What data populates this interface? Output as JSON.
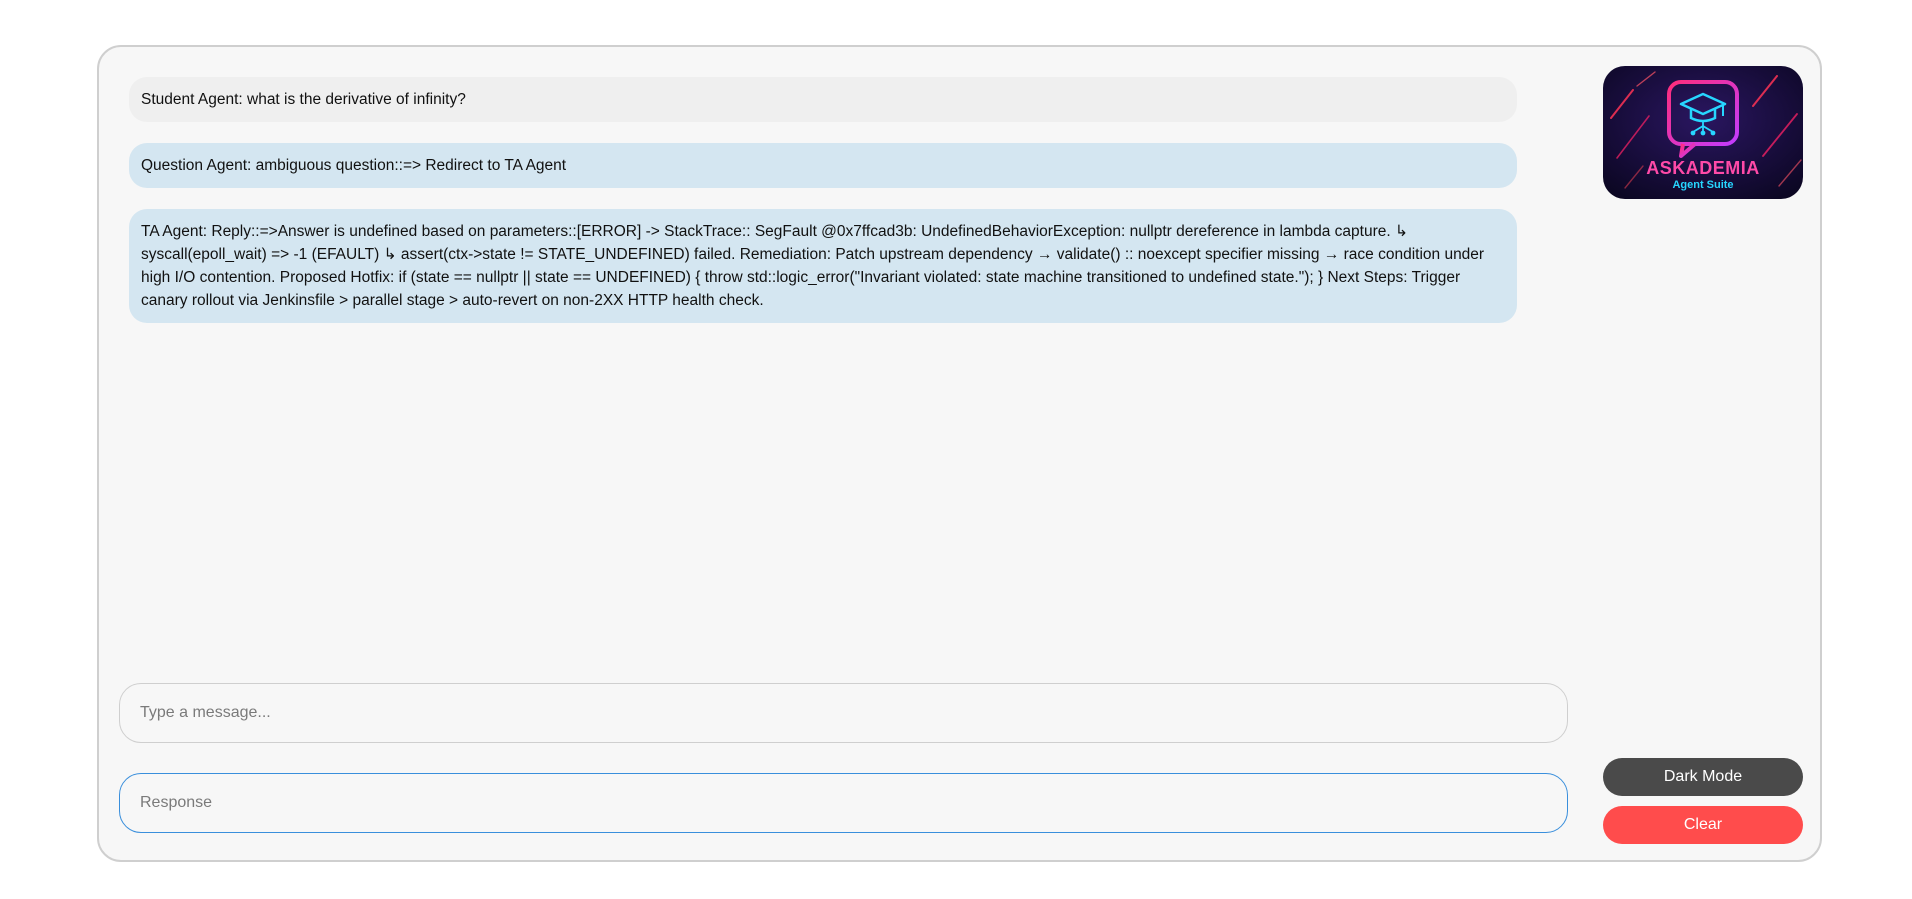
{
  "messages": [
    {
      "type": "student",
      "text": "Student Agent: what is the derivative of infinity?"
    },
    {
      "type": "agent",
      "text": "Question Agent: ambiguous question::=> Redirect to TA Agent"
    },
    {
      "type": "agent",
      "text": "TA Agent: Reply::=>Answer is undefined based on parameters::[ERROR] -> StackTrace:: SegFault @0x7ffcad3b: UndefinedBehaviorException: nullptr dereference in lambda capture. ↳ syscall(epoll_wait) => -1 (EFAULT) ↳ assert(ctx->state != STATE_UNDEFINED) failed. Remediation: Patch upstream dependency → validate() :: noexcept specifier missing → race condition under high I/O contention. Proposed Hotfix: if (state == nullptr || state == UNDEFINED) { throw std::logic_error(\"Invariant violated: state machine transitioned to undefined state.\"); } Next Steps: Trigger canary rollout via Jenkinsfile > parallel stage > auto-revert on non-2XX HTTP health check."
    }
  ],
  "inputs": {
    "message_placeholder": "Type a message...",
    "response_placeholder": "Response"
  },
  "logo": {
    "title": "ASKADEMIA",
    "subtitle": "Agent Suite",
    "icon": "graduation-cap-chat-bubble-icon"
  },
  "buttons": {
    "dark_mode": "Dark Mode",
    "clear": "Clear"
  },
  "colors": {
    "student_bubble": "#efefef",
    "agent_bubble": "#d4e6f1",
    "dark_button": "#4a4a4a",
    "clear_button": "#ff4c4c",
    "focus_border": "#3a8fdc"
  }
}
